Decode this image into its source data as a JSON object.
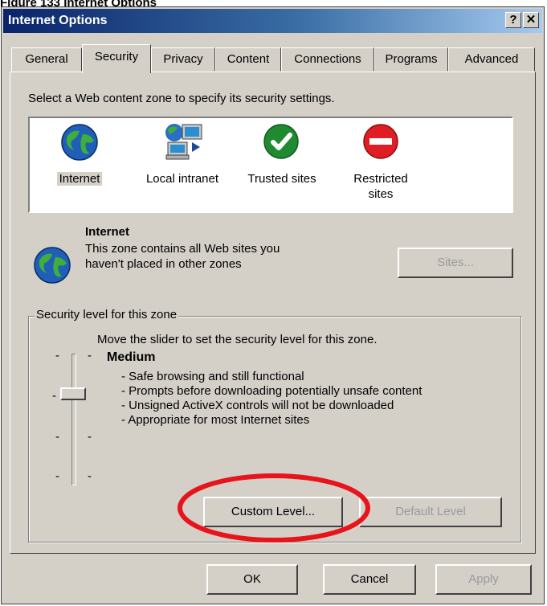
{
  "caption": "Figure 133 Internet Options",
  "window": {
    "title": "Internet Options",
    "help_button": "?",
    "close_button": "✕"
  },
  "tabs": [
    {
      "label": "General",
      "active": false
    },
    {
      "label": "Security",
      "active": true
    },
    {
      "label": "Privacy",
      "active": false
    },
    {
      "label": "Content",
      "active": false
    },
    {
      "label": "Connections",
      "active": false
    },
    {
      "label": "Programs",
      "active": false
    },
    {
      "label": "Advanced",
      "active": false
    }
  ],
  "zones": {
    "instruction": "Select a Web content zone to specify its security settings.",
    "items": [
      {
        "label": "Internet",
        "icon": "globe-icon",
        "selected": true
      },
      {
        "label": "Local intranet",
        "icon": "intranet-icon",
        "selected": false
      },
      {
        "label": "Trusted sites",
        "icon": "checkmark-icon",
        "selected": false
      },
      {
        "label": "Restricted sites",
        "icon": "restricted-icon",
        "selected": false
      }
    ]
  },
  "selected_zone": {
    "name": "Internet",
    "description_line1": "This zone contains all Web sites you",
    "description_line2": "haven't placed in other zones",
    "sites_button": "Sites..."
  },
  "security_level": {
    "group_label": "Security level for this zone",
    "instruction": "Move the slider to set the security level for this zone.",
    "level_name": "Medium",
    "level_index": 2,
    "level_count": 4,
    "descriptions": [
      "- Safe browsing and still functional",
      "- Prompts before downloading potentially unsafe content",
      "- Unsigned ActiveX controls will not be downloaded",
      "- Appropriate for most Internet sites"
    ],
    "custom_level_button": "Custom Level...",
    "default_level_button": "Default Level"
  },
  "footer": {
    "ok_button": "OK",
    "cancel_button": "Cancel",
    "apply_button": "Apply"
  },
  "colors": {
    "face": "#d4d0c8",
    "title_start": "#0a246a",
    "highlight_ellipse": "#e8141c"
  }
}
